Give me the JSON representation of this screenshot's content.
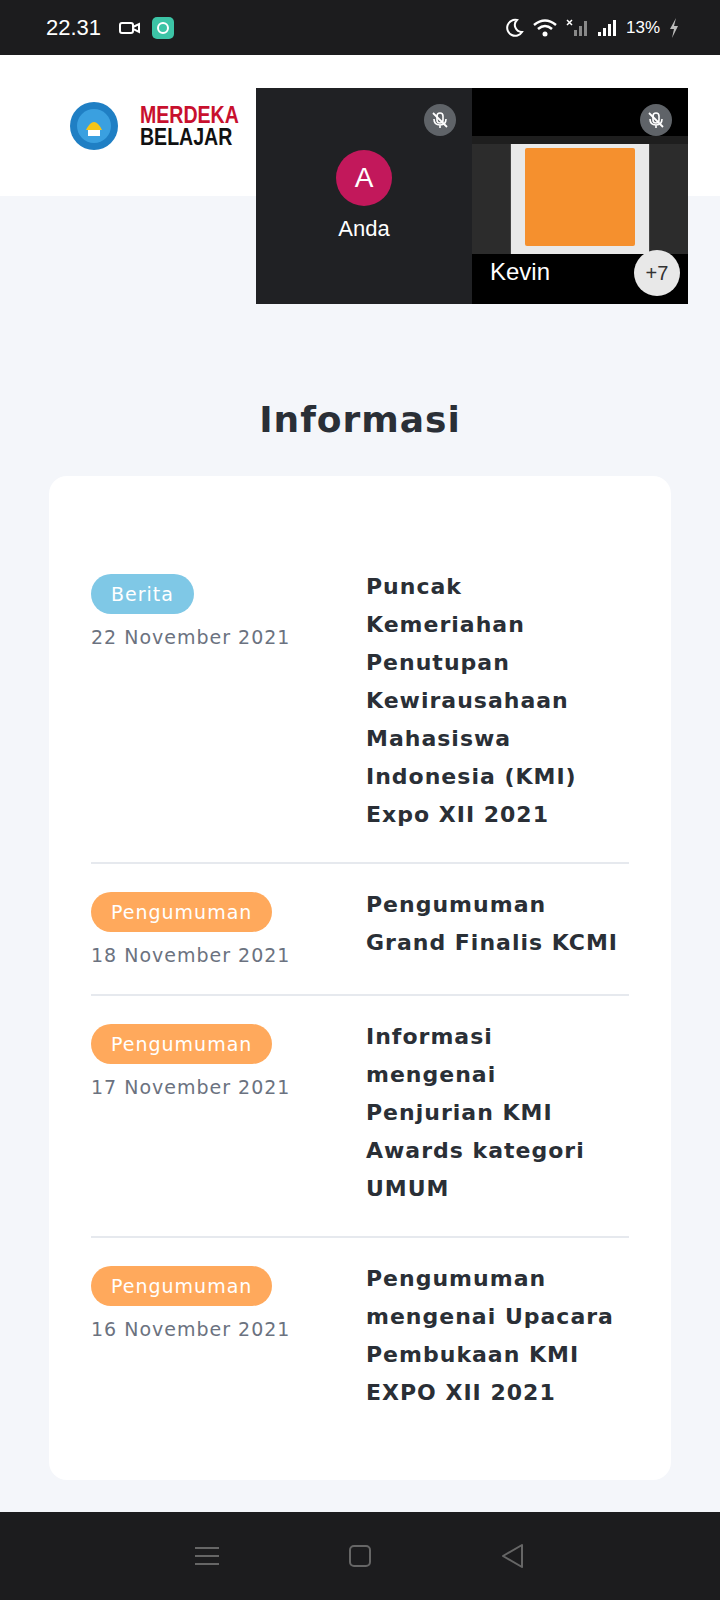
{
  "status_bar": {
    "time": "22.31",
    "battery": "13%"
  },
  "header": {
    "logo_text": [
      "MERDEKA",
      "BELAJAR"
    ]
  },
  "call": {
    "participants": [
      {
        "name": "Anda",
        "initial": "A",
        "muted": true,
        "kind": "avatar"
      },
      {
        "name": "Kevin",
        "muted": true,
        "kind": "screen"
      }
    ],
    "more": "+7"
  },
  "section_title": "Informasi",
  "items": [
    {
      "category": "Berita",
      "color": "#7fc8e6",
      "date": "22 November 2021",
      "title": "Puncak Kemeriahan Penutupan Kewirausahaan Mahasiswa Indonesia (KMI) Expo XII 2021"
    },
    {
      "category": "Pengumuman",
      "color": "#ffa95c",
      "date": "18 November 2021",
      "title": "Pengumuman Grand Finalis KCMI"
    },
    {
      "category": "Pengumuman",
      "color": "#ffa95c",
      "date": "17 November 2021",
      "title": "Informasi mengenai Penjurian KMI Awards kategori UMUM"
    },
    {
      "category": "Pengumuman",
      "color": "#ffa95c",
      "date": "16 November 2021",
      "title": "Pengumuman mengenai Upacara Pembukaan KMI EXPO XII 2021"
    }
  ]
}
